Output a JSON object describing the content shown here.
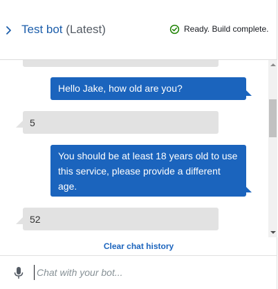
{
  "header": {
    "bot_name": "Test bot",
    "bot_version": "(Latest)",
    "status_text": "Ready. Build complete."
  },
  "messages": [
    {
      "from": "bot",
      "text": ""
    },
    {
      "from": "user",
      "text": "Hello Jake, how old are you?"
    },
    {
      "from": "bot",
      "text": "5"
    },
    {
      "from": "user",
      "text": "You should be at least 18 years old to use this service, please provide a different age."
    },
    {
      "from": "bot",
      "text": "52"
    }
  ],
  "clear_history_label": "Clear chat history",
  "input": {
    "value": "",
    "placeholder": "Chat with your bot..."
  },
  "colors": {
    "accent": "#1b64bd",
    "user_bubble": "#1b64bd",
    "bot_bubble": "#e2e2e2",
    "status_ok": "#1d8102"
  },
  "icons": {
    "expand": "chevron-right-icon",
    "status": "check-circle-icon",
    "mic": "microphone-icon"
  }
}
